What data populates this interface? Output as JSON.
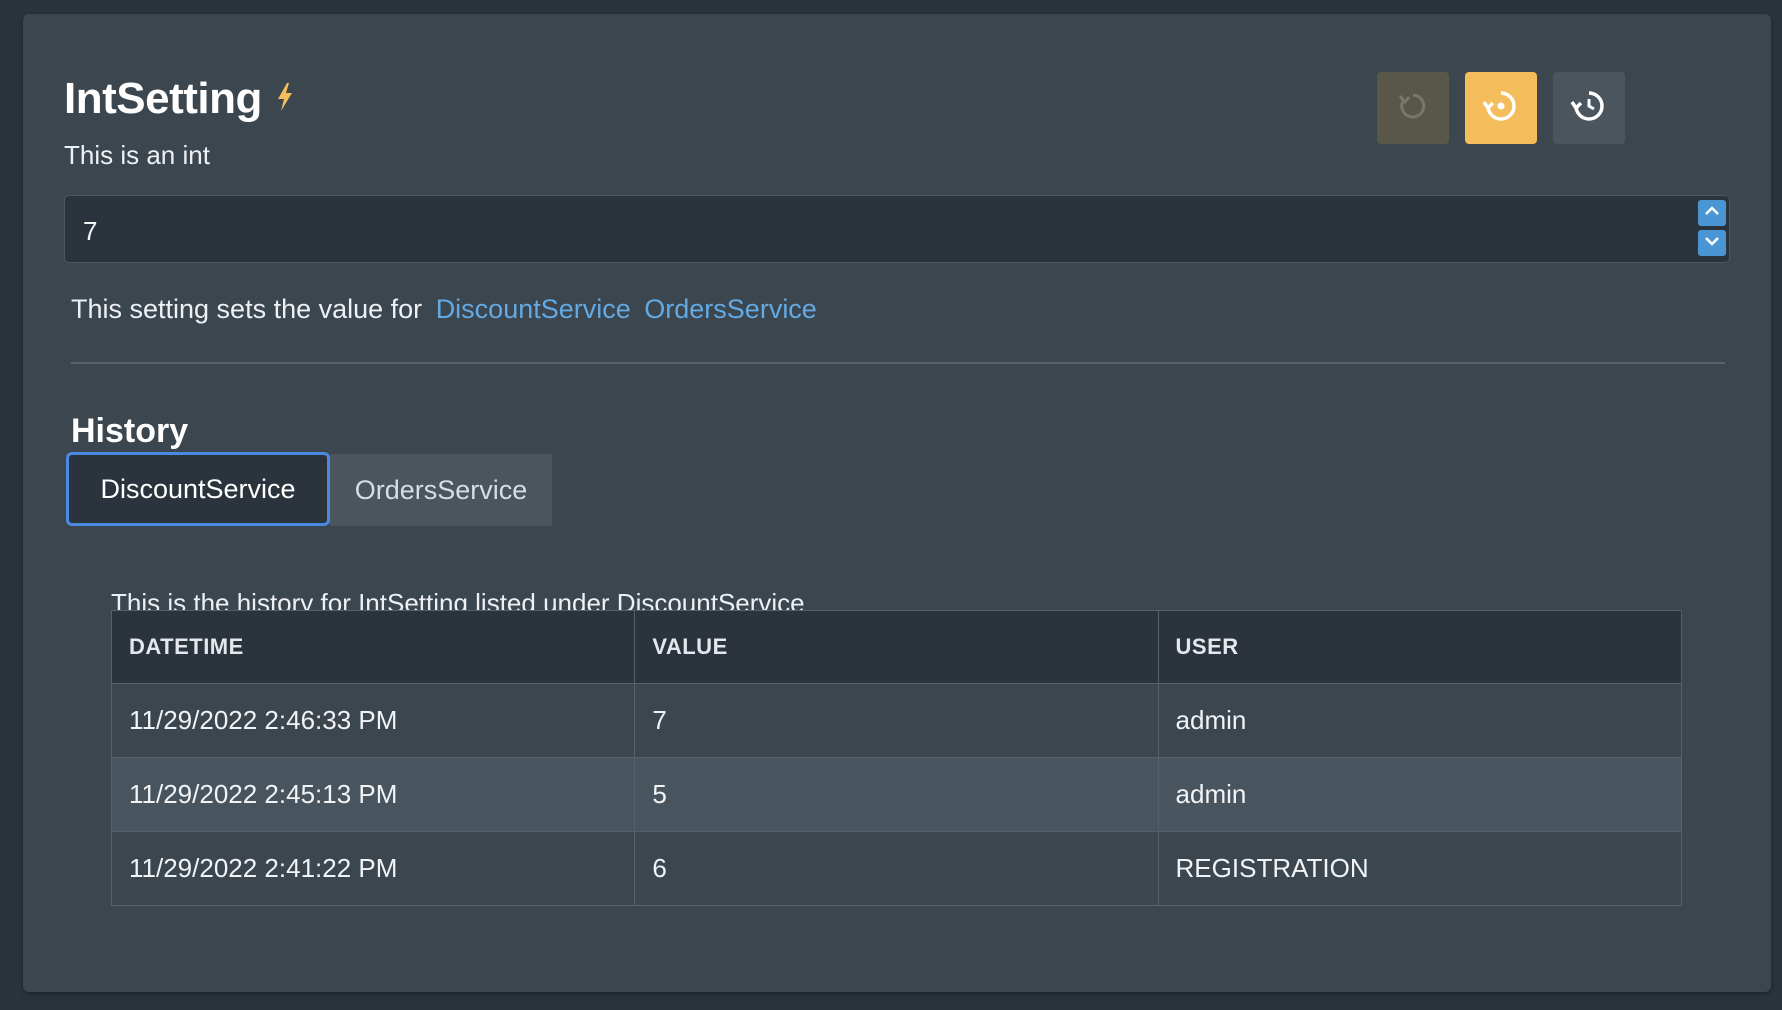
{
  "setting": {
    "title": "IntSetting",
    "description": "This is an int",
    "value": "7",
    "sets_prefix": "This setting sets the value for",
    "services": [
      "DiscountService",
      "OrdersService"
    ]
  },
  "actions": {
    "undo_icon": "undo-icon",
    "reset_icon": "reset-to-default-icon",
    "history_icon": "history-icon"
  },
  "history": {
    "heading": "History",
    "tabs": [
      {
        "label": "DiscountService",
        "active": true
      },
      {
        "label": "OrdersService",
        "active": false
      }
    ],
    "caption": "This is the history for IntSetting listed under DiscountService",
    "columns": [
      "DATETIME",
      "VALUE",
      "USER"
    ],
    "rows": [
      {
        "datetime": "11/29/2022 2:46:33 PM",
        "value": "7",
        "user": "admin"
      },
      {
        "datetime": "11/29/2022 2:45:13 PM",
        "value": "5",
        "user": "admin"
      },
      {
        "datetime": "11/29/2022 2:41:22 PM",
        "value": "6",
        "user": "REGISTRATION"
      }
    ]
  },
  "colors": {
    "accent": "#f3bd5c",
    "link": "#63a9e3",
    "tab_focus": "#4a8ae0"
  }
}
